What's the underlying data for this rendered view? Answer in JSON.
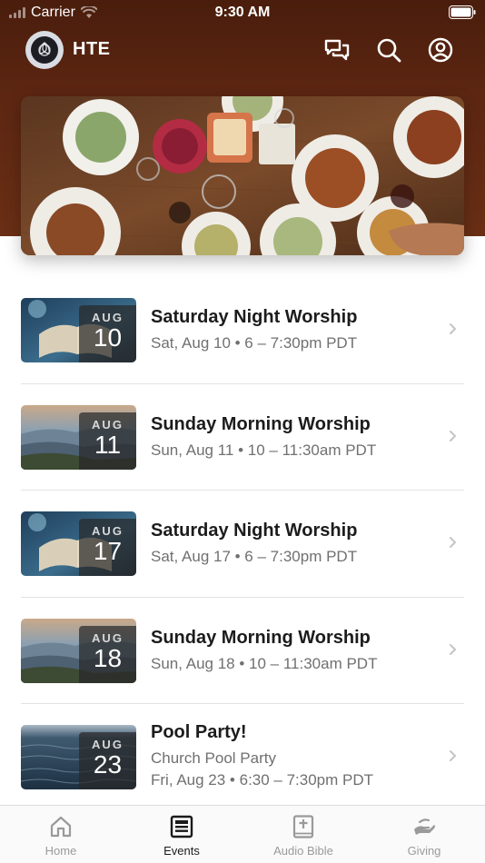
{
  "status_bar": {
    "carrier": "Carrier",
    "time": "9:30 AM"
  },
  "header": {
    "title": "HTE"
  },
  "colors": {
    "header_bg": "#5c2612",
    "accent": "#1a1a1a",
    "muted": "#9a9a9a"
  },
  "events": [
    {
      "month": "AUG",
      "day": "10",
      "title": "Saturday Night Worship",
      "lines": [
        "Sat, Aug 10 • 6 – 7:30pm PDT"
      ],
      "thumb": "bible"
    },
    {
      "month": "AUG",
      "day": "11",
      "title": "Sunday Morning Worship",
      "lines": [
        "Sun, Aug 11 • 10 – 11:30am PDT"
      ],
      "thumb": "mountains"
    },
    {
      "month": "AUG",
      "day": "17",
      "title": "Saturday Night Worship",
      "lines": [
        "Sat, Aug 17 • 6 – 7:30pm PDT"
      ],
      "thumb": "bible"
    },
    {
      "month": "AUG",
      "day": "18",
      "title": "Sunday Morning Worship",
      "lines": [
        "Sun, Aug 18 • 10 – 11:30am PDT"
      ],
      "thumb": "mountains"
    },
    {
      "month": "AUG",
      "day": "23",
      "title": "Pool Party!",
      "lines": [
        "Church Pool Party",
        "Fri, Aug 23 • 6:30 – 7:30pm PDT"
      ],
      "thumb": "water"
    }
  ],
  "tabs": [
    {
      "label": "Home",
      "icon": "home-icon",
      "active": false
    },
    {
      "label": "Events",
      "icon": "events-icon",
      "active": true
    },
    {
      "label": "Audio Bible",
      "icon": "bible-icon",
      "active": false
    },
    {
      "label": "Giving",
      "icon": "giving-icon",
      "active": false
    }
  ]
}
